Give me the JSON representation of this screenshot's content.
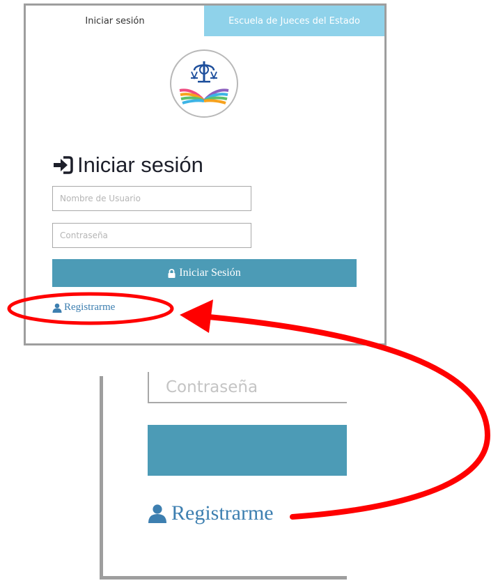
{
  "tabs": {
    "login": "Iniciar sesión",
    "school": "Escuela de Jueces del Estado"
  },
  "logo": {
    "icon": "scales-of-justice-book-logo"
  },
  "form": {
    "heading": "Iniciar sesión",
    "heading_icon": "sign-in-icon",
    "username_placeholder": "Nombre de Usuario",
    "password_placeholder": "Contraseña",
    "submit_label": "Iniciar Sesión",
    "submit_icon": "lock-icon",
    "register_label": "Registrarme",
    "register_icon": "user-icon"
  },
  "zoom": {
    "password_placeholder": "Contraseña",
    "register_label": "Registrarme"
  },
  "colors": {
    "accent": "#4c9bb6",
    "tab_active_bg": "#8fd2ea",
    "link": "#3d7fb0",
    "annotation": "#ff0000"
  }
}
